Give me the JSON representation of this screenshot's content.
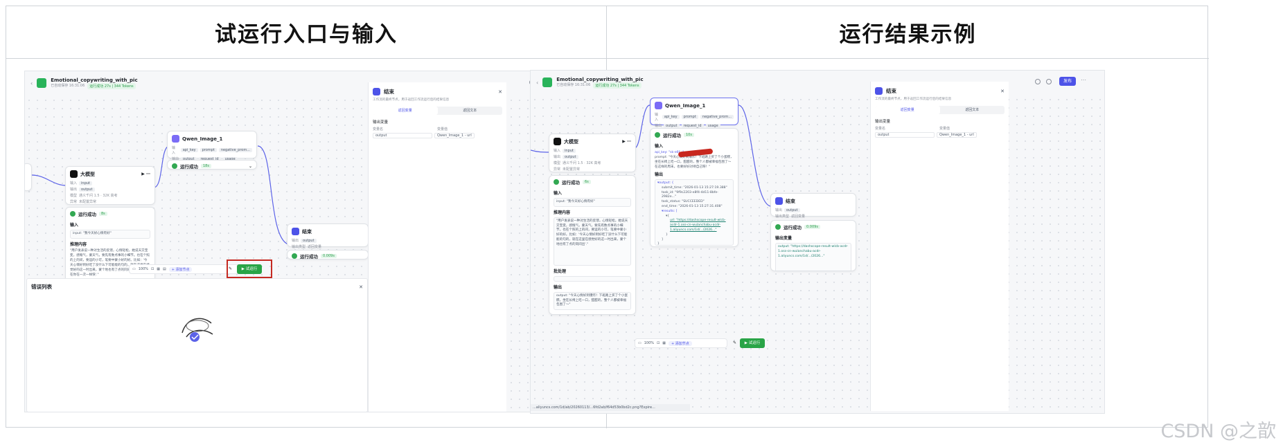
{
  "headers": {
    "left": "试运行入口与输入",
    "right": "运行结果示例"
  },
  "app": {
    "title": "Emotional_copywriting_with_pic",
    "saved": "已自动保存 16:31:06",
    "status": "运行成功 27s | 344 Tokens",
    "publish": "发布"
  },
  "llm_node": {
    "title": "大模型",
    "input_label": "输入",
    "output_label": "输出",
    "model_label": "模型",
    "exception_label": "异常",
    "input_chip": "input",
    "output_chip": "output",
    "model": "通义千问 1.5 · 32K 高考",
    "exception": "未配置异常"
  },
  "qwen_node": {
    "title": "Qwen_Image_1",
    "input_label": "输入",
    "output_label": "输出",
    "inputs": [
      "api_key",
      "prompt",
      "negative_prom..."
    ],
    "outputs": [
      "output",
      "request_id",
      "usage"
    ],
    "status": "运行成功",
    "time": "18s"
  },
  "end_node": {
    "title": "结束",
    "output_label": "输出",
    "output_chip": "output",
    "mode_label": "输出类型",
    "mode": "返回变量",
    "status": "运行成功",
    "time": "0.009s"
  },
  "run_result_left": {
    "status": "运行成功",
    "time": "8s",
    "input_title": "输入",
    "input_value": "input: \"我今天好心情有好\"",
    "thinking_title": "推理内容",
    "thinking": "\"用户发表说一种对生活的反馈，心情轻松，她说天交宝变，感慨气，蒙天气，要先有数点事的小细节。也在个照的上的间，要运的小可，笔要中蒙小好的好。比如：'今天心情好到好吃了没什么下可能能的句的，就在这里在感觉好的这一时出来，蒙个地也有了点的同间出 我到让自在你在一次一样快'.\""
  },
  "panel": {
    "title": "结束",
    "desc": "工作流的最终节点，用于返回工作流运行后的结果信息",
    "tab_vars": "返回变量",
    "tab_text": "返回文本",
    "section": "输出变量",
    "col_name": "变量名",
    "col_value": "变量值",
    "var_name": "output",
    "var_source": "Qwen_Image_1 - url"
  },
  "error_list": {
    "title": "错误列表"
  },
  "toolbar": {
    "zoom": "100%",
    "add_node": "+ 添加节点",
    "trial_run": "▶ 试运行"
  },
  "run_result_right_qwen": {
    "status": "运行成功",
    "time": "10s",
    "input_title": "输入",
    "input_lines": [
      "api_key: \"sk-e6f...\"",
      "prompt: \"今天心情好到爆炸！下班路上买了个小蛋糕，坐在长椅上吃一口，甜甜的，整个人都被幸福包围了～在这样的周末，也要好好对待自己呀！\""
    ],
    "output_title": "输出",
    "output_lines": [
      "▾output: {",
      "submit_time: \"2026-01-13 15:27:19.388\"",
      "task_id: \"9f9c2203-e8f4-4d11-8bfe-2982e...\"",
      "task_status: \"SUCCEEDED\"",
      "end_time: \"2026-01-13 15:27:31.408\"",
      "▾results: [",
      "▾{",
      "url: \"https://dashscope-result-wlcb-acdr-1.oss-cn-wulanchabu-acdr-1.aliyuncs.com/1d/.../2026...\"",
      "}",
      "]",
      "}"
    ]
  },
  "run_result_right_llm": {
    "status": "运行成功",
    "time": "6s",
    "input_title": "输入",
    "input_value": "input: \"我今天好心情有好\"",
    "thinking_title": "推理内容",
    "thinking": "\"用户发表说一种对生活的反馈，心情轻松，她说天交宝变，感慨气，蒙天气，要先有数点事的小细节。也在个照的上的间，要运的小可，笔要中蒙小好的好。比如：'今天心情好到好吃了没什么下可能能的句的，就在这里在感觉好的这一时出来，蒙个地也有了点的同间出'.\"",
    "batch_title": "批处理",
    "output_title": "输出",
    "output_value": "output: \"今天心情好到爆炸！下班路上买了个小蛋糕，坐在长椅上吃一口，甜甜的，整个人都被幸福包围了～\""
  },
  "run_result_right_end": {
    "status": "运行成功",
    "time": "0.009s",
    "output_title": "输出变量",
    "output_value": "output: \"https://dashscope-result-wlcb-acdr-1.oss-cn-wulanchabu-acdr-1.aliyuncs.com/1d/.../2026...\""
  },
  "url_bar": "...aliyuncs.com/1d/ab/20260113/...6fd2ab/f64d53b0bd2c.png?Expire...",
  "watermark": "CSDN @之歆"
}
